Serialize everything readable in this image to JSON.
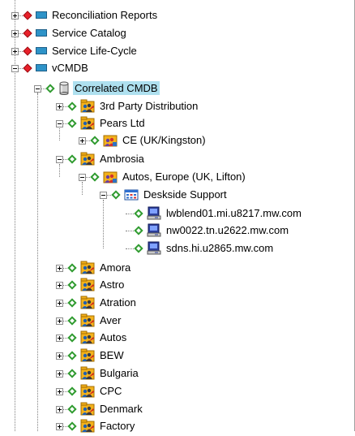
{
  "tree": {
    "items": [
      {
        "label": "Reconciliation Reports",
        "icon": "category-icon",
        "expanded": false
      },
      {
        "label": "Service Catalog",
        "icon": "category-icon",
        "expanded": false
      },
      {
        "label": "Service Life-Cycle",
        "icon": "category-icon",
        "expanded": false
      },
      {
        "label": "vCMDB",
        "icon": "category-icon",
        "expanded": true
      },
      {
        "label": "Correlated CMDB",
        "icon": "database-icon",
        "expanded": true,
        "selected": true
      },
      {
        "label": "3rd Party Distribution",
        "icon": "organization-icon",
        "expanded": false
      },
      {
        "label": "Pears Ltd",
        "icon": "organization-icon",
        "expanded": true
      },
      {
        "label": "CE (UK/Kingston)",
        "icon": "location-icon",
        "expanded": false
      },
      {
        "label": "Ambrosia",
        "icon": "organization-icon",
        "expanded": true
      },
      {
        "label": "Autos, Europe (UK, Lifton)",
        "icon": "location-icon",
        "expanded": true
      },
      {
        "label": "Deskside Support",
        "icon": "business-service-icon",
        "expanded": true
      },
      {
        "label": "lwblend01.mi.u8217.mw.com",
        "icon": "computer-icon"
      },
      {
        "label": "nw0022.tn.u2622.mw.com",
        "icon": "computer-icon"
      },
      {
        "label": "sdns.hi.u2865.mw.com",
        "icon": "computer-icon"
      },
      {
        "label": "Amora",
        "icon": "organization-icon",
        "expanded": false
      },
      {
        "label": "Astro",
        "icon": "organization-icon",
        "expanded": false
      },
      {
        "label": "Atration",
        "icon": "organization-icon",
        "expanded": false
      },
      {
        "label": "Aver",
        "icon": "organization-icon",
        "expanded": false
      },
      {
        "label": "Autos",
        "icon": "organization-icon",
        "expanded": false
      },
      {
        "label": "BEW",
        "icon": "organization-icon",
        "expanded": false
      },
      {
        "label": "Bulgaria",
        "icon": "organization-icon",
        "expanded": false
      },
      {
        "label": "CPC",
        "icon": "organization-icon",
        "expanded": false
      },
      {
        "label": "Denmark",
        "icon": "organization-icon",
        "expanded": false
      },
      {
        "label": "Factory",
        "icon": "organization-icon",
        "expanded": false
      }
    ]
  },
  "colors": {
    "selection": "#aee0ef",
    "status_red": "#e8202a",
    "status_green": "#2f9b2f",
    "category_blue": "#2e93c8"
  }
}
